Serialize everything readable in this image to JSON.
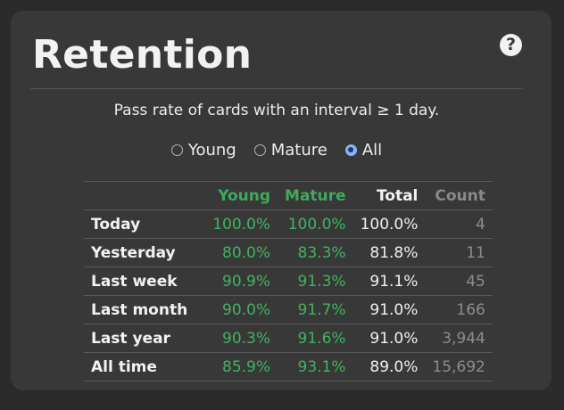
{
  "title": "Retention",
  "help_icon": "question-circle-icon",
  "subtitle": "Pass rate of cards with an interval ≥ 1 day.",
  "radios": [
    {
      "label": "Young",
      "checked": false
    },
    {
      "label": "Mature",
      "checked": false
    },
    {
      "label": "All",
      "checked": true
    }
  ],
  "table": {
    "headers": [
      "",
      "Young",
      "Mature",
      "Total",
      "Count"
    ],
    "rows": [
      {
        "label": "Today",
        "young": "100.0%",
        "mature": "100.0%",
        "total": "100.0%",
        "count": "4"
      },
      {
        "label": "Yesterday",
        "young": "80.0%",
        "mature": "83.3%",
        "total": "81.8%",
        "count": "11"
      },
      {
        "label": "Last week",
        "young": "90.9%",
        "mature": "91.3%",
        "total": "91.1%",
        "count": "45"
      },
      {
        "label": "Last month",
        "young": "90.0%",
        "mature": "91.7%",
        "total": "91.0%",
        "count": "166"
      },
      {
        "label": "Last year",
        "young": "90.3%",
        "mature": "91.6%",
        "total": "91.0%",
        "count": "3,944"
      },
      {
        "label": "All time",
        "young": "85.9%",
        "mature": "93.1%",
        "total": "89.0%",
        "count": "15,692"
      }
    ]
  },
  "colors": {
    "background": "#2b2b2b",
    "card": "#383838",
    "young": "#48b865",
    "mature": "#3aa852",
    "count": "#8c8c8c",
    "radio_checked": "#8ab4f8"
  }
}
